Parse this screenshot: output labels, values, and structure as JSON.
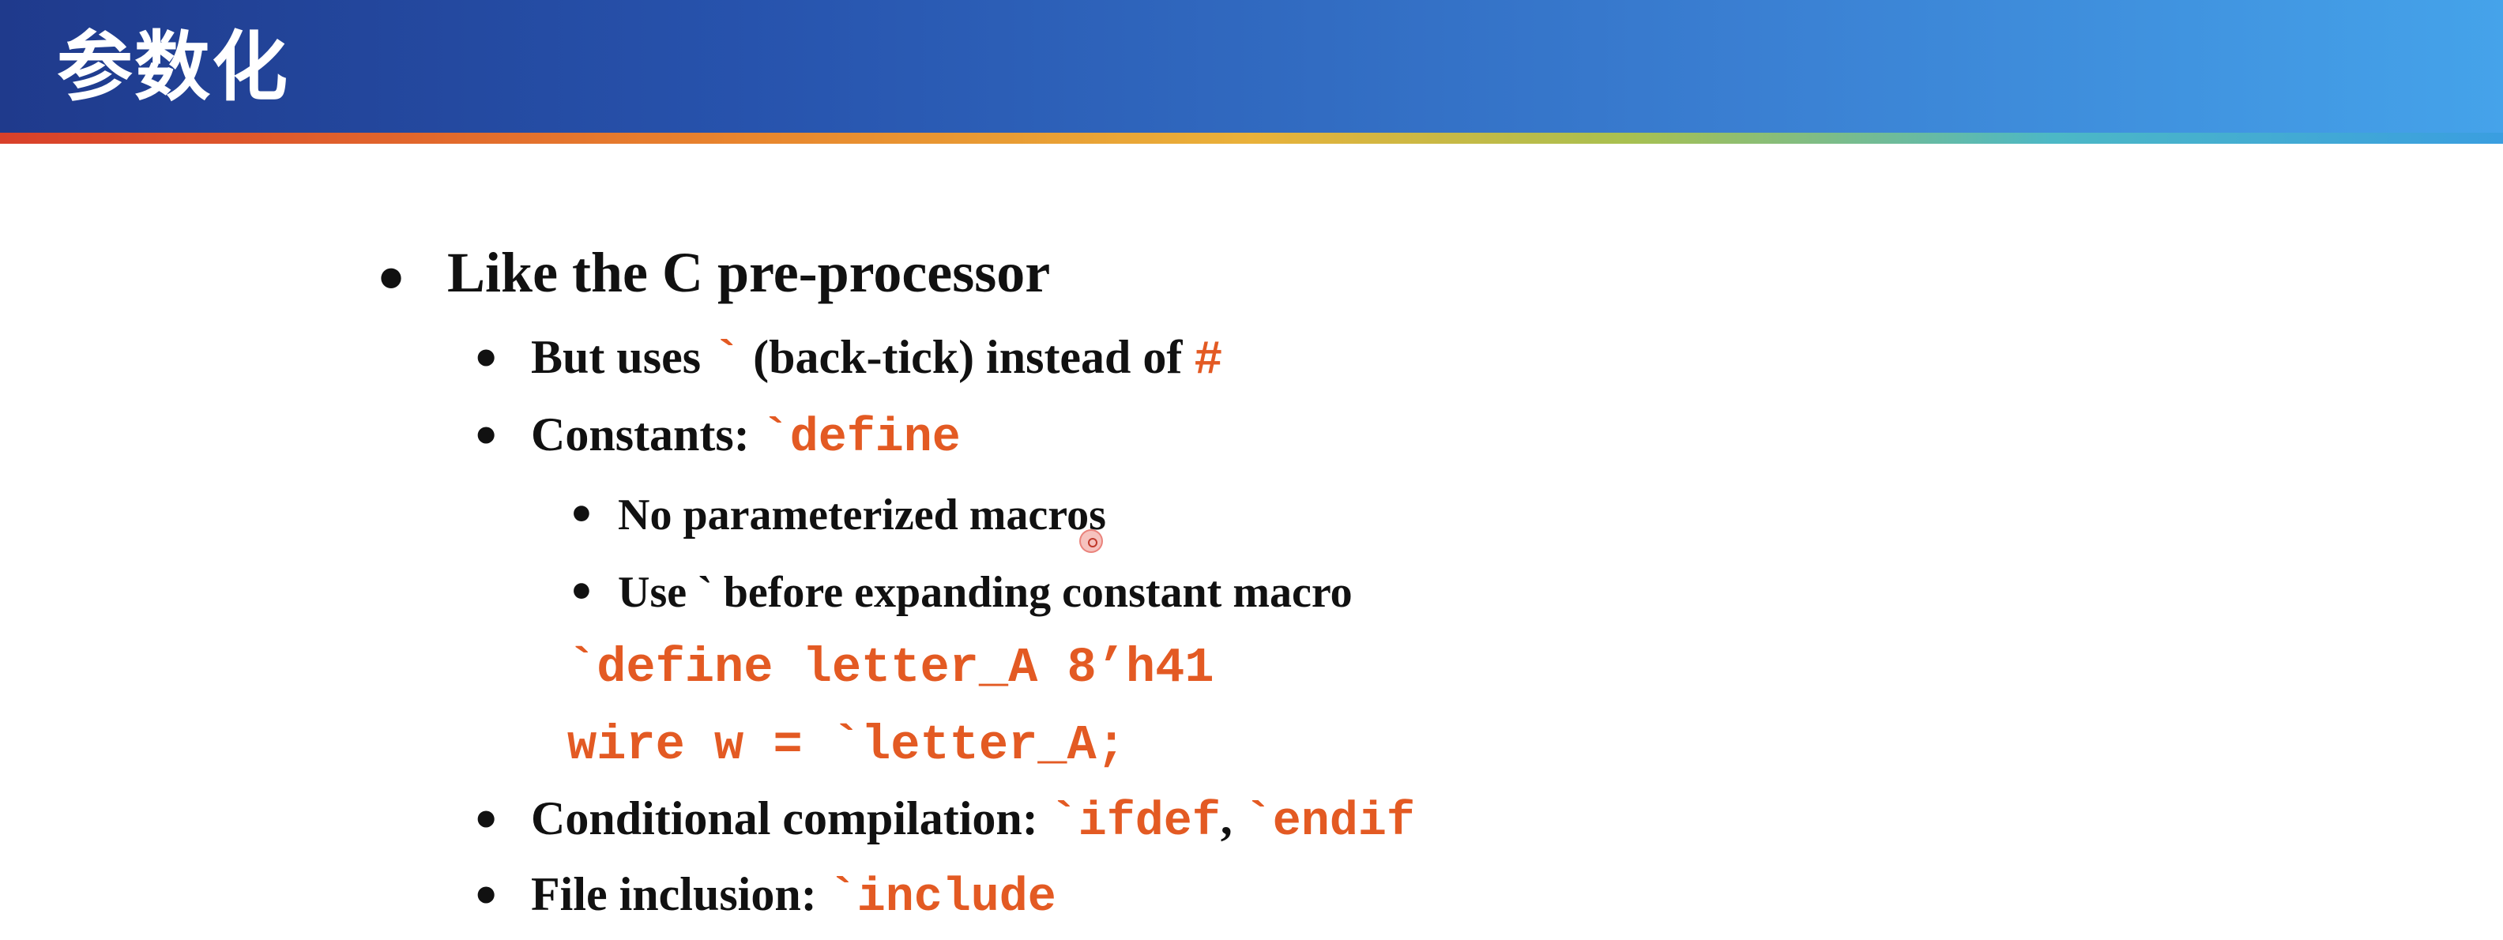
{
  "header": {
    "title": "参数化"
  },
  "colors": {
    "header_gradient_start": "#1f3a8c",
    "header_gradient_end": "#45a3ea",
    "code_accent": "#e35a23",
    "text": "#111111"
  },
  "bullets": {
    "b1": {
      "marker": "•",
      "text": "Like the C pre-processor"
    },
    "b1_1": {
      "marker": "•",
      "prefix": "But uses ",
      "tick": "`",
      "middle": " (back-tick) instead of ",
      "hash": "#"
    },
    "b1_2": {
      "marker": "•",
      "prefix": "Constants: ",
      "code": "`define"
    },
    "b1_2_1": {
      "marker": "•",
      "text": "No parameterized macros"
    },
    "b1_2_2": {
      "marker": "•",
      "text": "Use ` before expanding constant macro"
    },
    "code_line_1": "`define letter_A 8’h41",
    "code_line_2": "wire w = `letter_A;",
    "b1_3": {
      "marker": "•",
      "prefix": "Conditional compilation: ",
      "code1": "`ifdef",
      "sep": ", ",
      "code2": "`endif"
    },
    "b1_4": {
      "marker": "•",
      "prefix": "File inclusion: ",
      "code": "`include"
    }
  }
}
